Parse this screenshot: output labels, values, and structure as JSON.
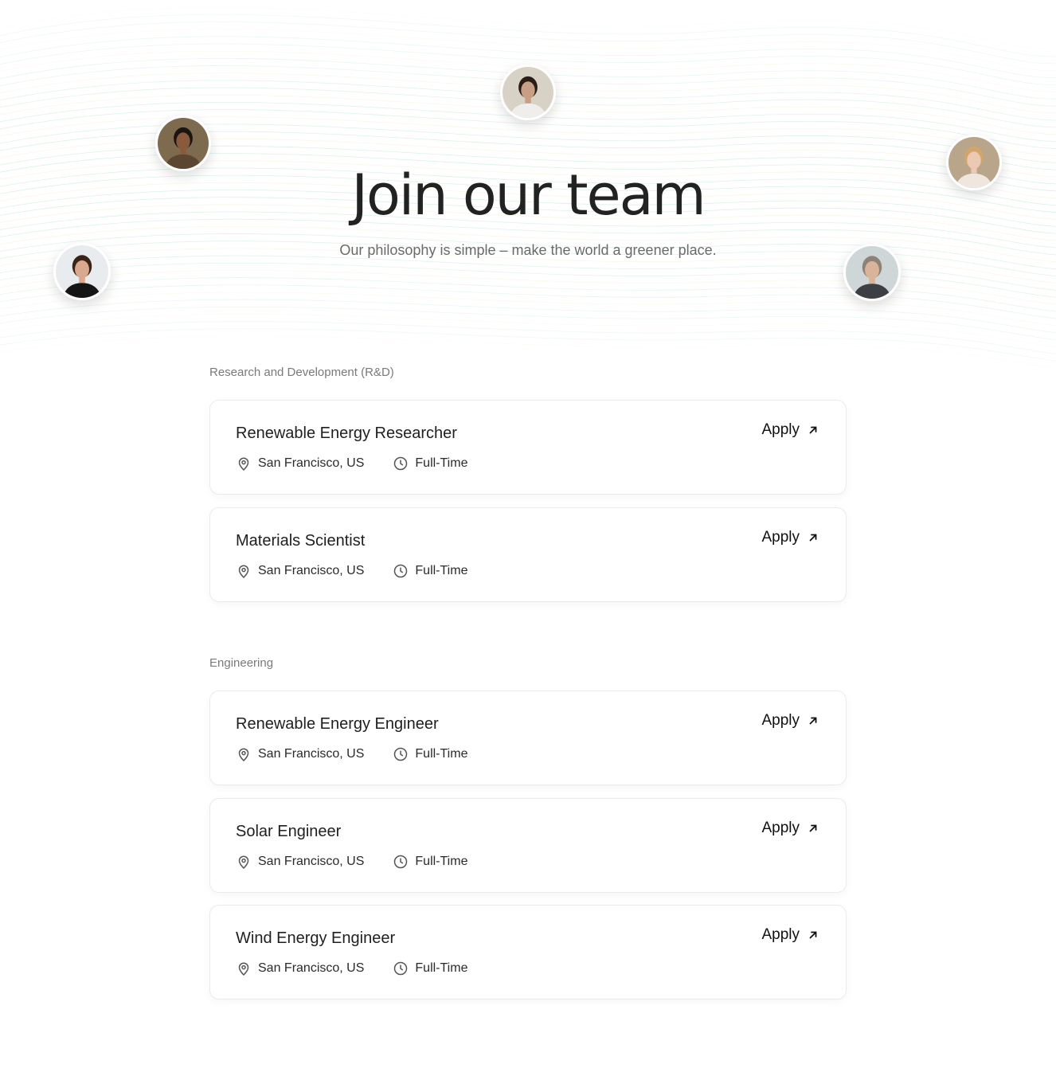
{
  "hero": {
    "title": "Join our team",
    "subtitle": "Our philosophy is simple – make the world a greener place."
  },
  "avatars": [
    {
      "name": "team-member-avatar-1",
      "bg": "#d8d2c6",
      "skin": "#c89f84",
      "hair": "#2b1d16",
      "shirt": "#f0eeea"
    },
    {
      "name": "team-member-avatar-2",
      "bg": "#7e6a4e",
      "skin": "#8a5a3c",
      "hair": "#1b1410",
      "shirt": "#5b4631"
    },
    {
      "name": "team-member-avatar-3",
      "bg": "#b9a58a",
      "skin": "#ecc9b2",
      "hair": "#d2a56c",
      "shirt": "#efe6df"
    },
    {
      "name": "team-member-avatar-4",
      "bg": "#e9ecee",
      "skin": "#d8a98e",
      "hair": "#3a2417",
      "shirt": "#151515"
    },
    {
      "name": "team-member-avatar-5",
      "bg": "#cfd6d8",
      "skin": "#d9b39a",
      "hair": "#8c8378",
      "shirt": "#3e3f45"
    }
  ],
  "sections": [
    {
      "label": "Research and Development (R&D)",
      "jobs": [
        {
          "title": "Renewable Energy Researcher",
          "location": "San Francisco, US",
          "type": "Full-Time",
          "apply_label": "Apply"
        },
        {
          "title": "Materials Scientist",
          "location": "San Francisco, US",
          "type": "Full-Time",
          "apply_label": "Apply"
        }
      ]
    },
    {
      "label": "Engineering",
      "jobs": [
        {
          "title": "Renewable Energy Engineer",
          "location": "San Francisco, US",
          "type": "Full-Time",
          "apply_label": "Apply"
        },
        {
          "title": "Solar Engineer",
          "location": "San Francisco, US",
          "type": "Full-Time",
          "apply_label": "Apply"
        },
        {
          "title": "Wind Energy Engineer",
          "location": "San Francisco, US",
          "type": "Full-Time",
          "apply_label": "Apply"
        }
      ]
    }
  ],
  "icons": {
    "location": "map-pin-icon",
    "job_type": "clock-icon",
    "apply": "arrow-up-right-icon"
  },
  "colors": {
    "wave_green": "#7fcf9e",
    "wave_yellow": "#ece3a0",
    "card_border": "#ebebeb"
  }
}
